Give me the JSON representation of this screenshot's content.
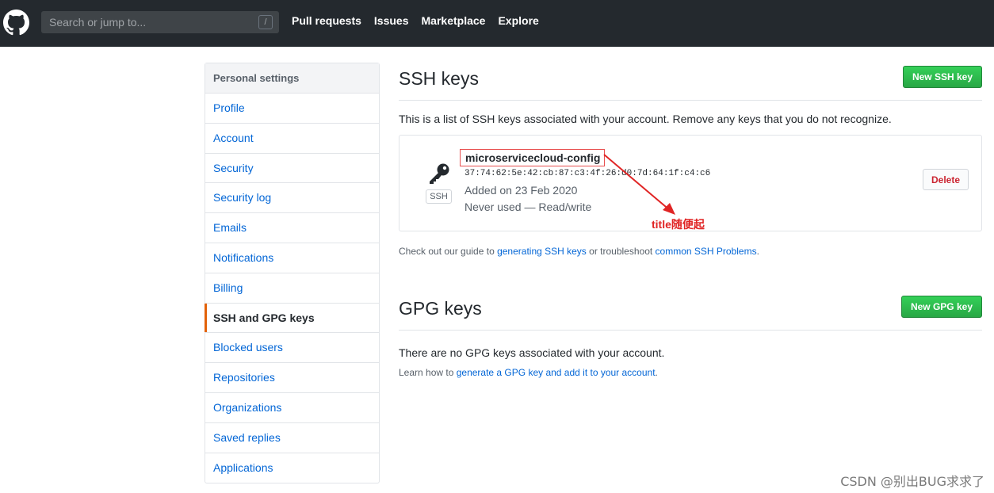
{
  "header": {
    "search_placeholder": "Search or jump to...",
    "search_shortcut": "/",
    "nav": [
      "Pull requests",
      "Issues",
      "Marketplace",
      "Explore"
    ]
  },
  "sidebar": {
    "title": "Personal settings",
    "items": [
      {
        "label": "Profile"
      },
      {
        "label": "Account"
      },
      {
        "label": "Security"
      },
      {
        "label": "Security log"
      },
      {
        "label": "Emails"
      },
      {
        "label": "Notifications"
      },
      {
        "label": "Billing"
      },
      {
        "label": "SSH and GPG keys",
        "active": true
      },
      {
        "label": "Blocked users"
      },
      {
        "label": "Repositories"
      },
      {
        "label": "Organizations"
      },
      {
        "label": "Saved replies"
      },
      {
        "label": "Applications"
      }
    ]
  },
  "ssh": {
    "title": "SSH keys",
    "new_button": "New SSH key",
    "description": "This is a list of SSH keys associated with your account. Remove any keys that you do not recognize.",
    "key": {
      "icon": "key-icon",
      "badge": "SSH",
      "title": "microservicecloud-config",
      "fingerprint": "37:74:62:5e:42:cb:87:c3:4f:26:d0:7d:64:1f:c4:c6",
      "added": "Added on 23 Feb 2020",
      "usage": "Never used — Read/write",
      "delete_button": "Delete"
    },
    "annotation": "title随便起",
    "guide_prefix": "Check out our guide to ",
    "guide_link1": "generating SSH keys",
    "guide_middle": " or troubleshoot ",
    "guide_link2": "common SSH Problems",
    "guide_suffix": "."
  },
  "gpg": {
    "title": "GPG keys",
    "new_button": "New GPG key",
    "empty": "There are no GPG keys associated with your account.",
    "learn_prefix": "Learn how to ",
    "learn_link": "generate a GPG key and add it to your account",
    "learn_suffix": "."
  },
  "watermark": "CSDN @别出BUG求求了",
  "colors": {
    "header_bg": "#24292e",
    "link": "#0366d6",
    "primary_green": "#28a745",
    "danger": "#cb2431",
    "active_accent": "#e36209",
    "annotation": "#e02424"
  }
}
